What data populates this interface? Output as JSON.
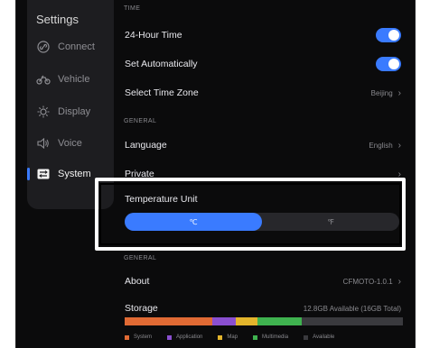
{
  "sidebar": {
    "title": "Settings",
    "items": [
      {
        "label": "Connect",
        "icon": "connect-icon"
      },
      {
        "label": "Vehicle",
        "icon": "motorcycle-icon"
      },
      {
        "label": "Display",
        "icon": "sun-icon"
      },
      {
        "label": "Voice",
        "icon": "speaker-icon"
      },
      {
        "label": "System",
        "icon": "system-icon"
      }
    ]
  },
  "time": {
    "section_label": "TIME",
    "rows": [
      {
        "label": "24-Hour Time",
        "toggle": true
      },
      {
        "label": "Set Automatically",
        "toggle": true
      },
      {
        "label": "Select Time Zone",
        "value": "Beijing"
      }
    ]
  },
  "general": {
    "section_label": "GENERAL",
    "rows": [
      {
        "label": "Language",
        "value": "English"
      },
      {
        "label": "Private",
        "value": ""
      }
    ]
  },
  "temperature": {
    "label": "Temperature Unit",
    "options": [
      "℃",
      "℉"
    ],
    "selected": "℃"
  },
  "general2": {
    "section_label": "GENERAL",
    "about": {
      "label": "About",
      "value": "CFMOTO-1.0.1"
    },
    "storage": {
      "label": "Storage",
      "value": "12.8GB Available (16GB Total)"
    }
  },
  "storage_breakdown": [
    {
      "label": "System",
      "color": "#e06a34",
      "fraction": 0.315
    },
    {
      "label": "Application",
      "color": "#8a4fd0",
      "fraction": 0.083
    },
    {
      "label": "Map",
      "color": "#e3b52c",
      "fraction": 0.08
    },
    {
      "label": "Multimedia",
      "color": "#3fb24f",
      "fraction": 0.157
    },
    {
      "label": "Available",
      "color": "#3a3a3e",
      "fraction": 0.365
    }
  ],
  "colors": {
    "accent": "#3a7bff",
    "background": "#0b0b0c",
    "sidebar": "#1d1d20"
  }
}
